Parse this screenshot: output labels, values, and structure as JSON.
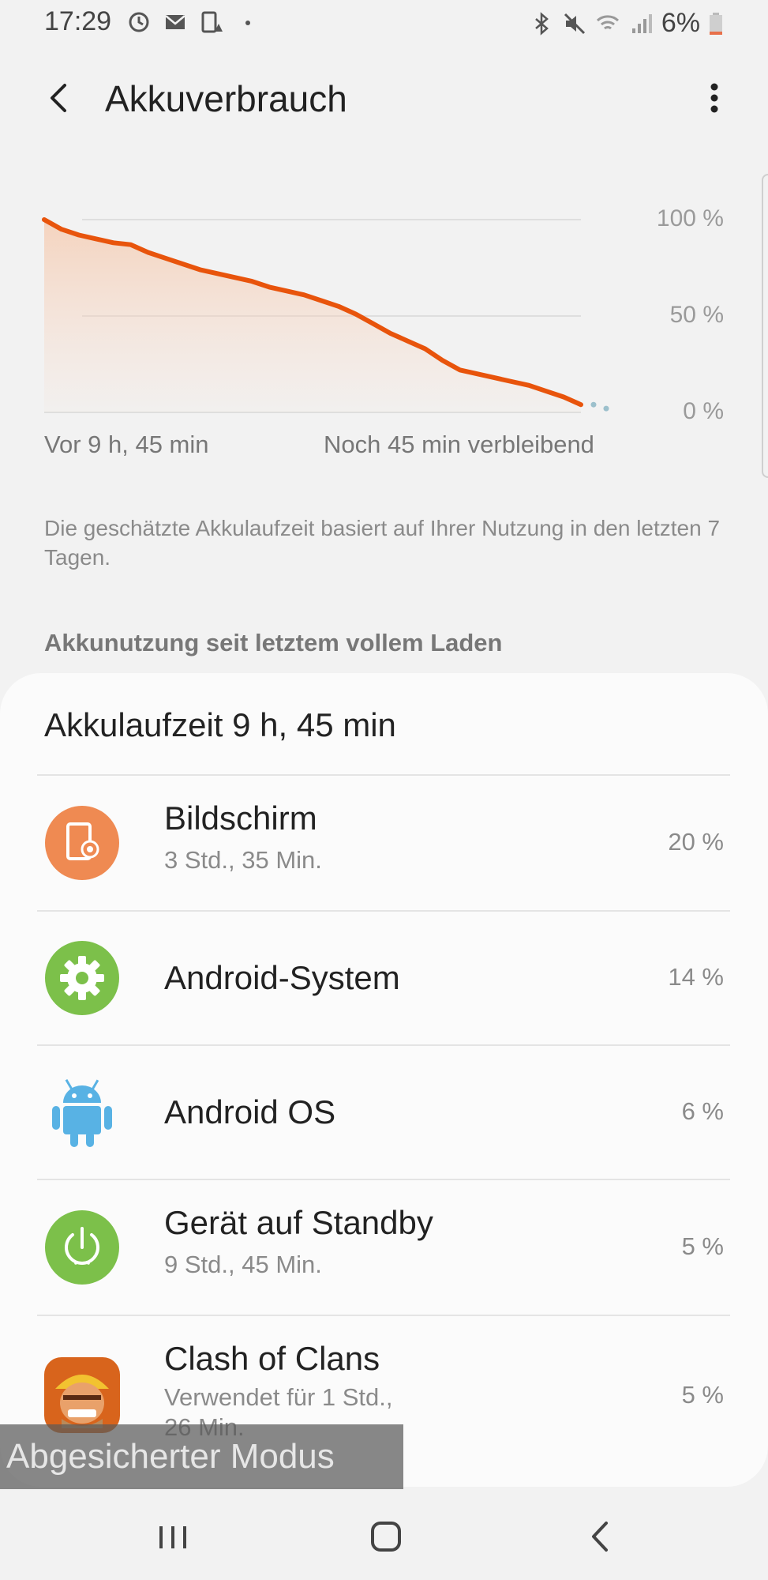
{
  "status_bar": {
    "time": "17:29",
    "battery_text": "6%",
    "left_icons": [
      "sync-icon",
      "mail-icon",
      "device-warning-icon",
      "dot-icon"
    ],
    "right_icons": [
      "bluetooth-icon",
      "mute-icon",
      "wifi-icon",
      "signal-icon",
      "battery-icon"
    ],
    "battery_level": 0.06
  },
  "header": {
    "title": "Akkuverbrauch",
    "back_icon": "chevron-left-icon",
    "more_icon": "more-vert-icon"
  },
  "chart": {
    "y_labels": [
      "100 %",
      "50 %",
      "0 %"
    ],
    "x_label_left": "Vor 9 h, 45 min",
    "x_label_right": "Noch 45 min verbleibend",
    "line_color": "#e8540c",
    "prediction_color": "#9cc0cc"
  },
  "chart_data": {
    "type": "line",
    "ylim": [
      0,
      100
    ],
    "series": [
      {
        "values": [
          100,
          95,
          92,
          90,
          88,
          87,
          83,
          80,
          77,
          74,
          72,
          70,
          68,
          65,
          63,
          61,
          58,
          55,
          51,
          46,
          41,
          37,
          33,
          27,
          22,
          20,
          18,
          16,
          14,
          11,
          8,
          4
        ]
      }
    ],
    "prediction": [
      4,
      2
    ]
  },
  "info_text": "Die geschätzte Akkulaufzeit basiert auf Ihrer Nutzung in den letzten 7 Tagen.",
  "section_title": "Akkunutzung seit letztem vollem Laden",
  "card": {
    "title": "Akkulaufzeit 9 h, 45 min",
    "items": [
      {
        "title": "Bildschirm",
        "subtitle": "3 Std., 35 Min.",
        "percent": "20 %",
        "icon": "screen-brightness-icon",
        "icon_color": "#ef8a52"
      },
      {
        "title": "Android-System",
        "subtitle": "",
        "percent": "14 %",
        "icon": "gear-icon",
        "icon_color": "#7cc04a"
      },
      {
        "title": "Android OS",
        "subtitle": "",
        "percent": "6 %",
        "icon": "android-robot-icon",
        "icon_color": "#58b2e4"
      },
      {
        "title": "Gerät auf Standby",
        "subtitle": "9 Std., 45 Min.",
        "percent": "5 %",
        "icon": "power-icon",
        "icon_color": "#7cc04a"
      },
      {
        "title": "Clash of Clans",
        "subtitle_line1": "Verwendet für 1 Std.,",
        "subtitle_line2": "26 Min.",
        "percent": "5 %",
        "icon": "clash-of-clans-app-icon",
        "icon_color": "#d8641c"
      }
    ]
  },
  "watermark": "Abgesicherter Modus",
  "nav": {
    "recent_icon": "recent-apps-icon",
    "home_icon": "home-icon",
    "back_icon": "back-icon"
  }
}
